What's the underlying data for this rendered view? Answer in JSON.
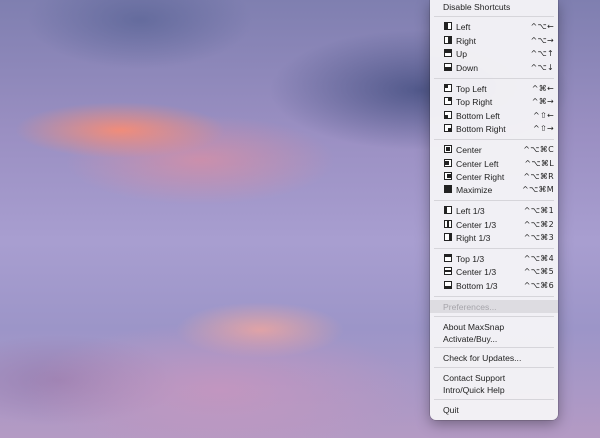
{
  "menu": {
    "disable_shortcuts": "Disable Shortcuts",
    "halves": [
      {
        "label": "Left",
        "shortcut": "^⌥←",
        "icon": "left-half-icon"
      },
      {
        "label": "Right",
        "shortcut": "^⌥→",
        "icon": "right-half-icon"
      },
      {
        "label": "Up",
        "shortcut": "^⌥↑",
        "icon": "top-half-icon"
      },
      {
        "label": "Down",
        "shortcut": "^⌥↓",
        "icon": "bottom-half-icon"
      }
    ],
    "quarters": [
      {
        "label": "Top Left",
        "shortcut": "^⌘←",
        "icon": "top-left-quarter-icon"
      },
      {
        "label": "Top Right",
        "shortcut": "^⌘→",
        "icon": "top-right-quarter-icon"
      },
      {
        "label": "Bottom Left",
        "shortcut": "^⇧←",
        "icon": "bottom-left-quarter-icon"
      },
      {
        "label": "Bottom Right",
        "shortcut": "^⇧→",
        "icon": "bottom-right-quarter-icon"
      }
    ],
    "center": [
      {
        "label": "Center",
        "shortcut": "^⌥⌘C",
        "icon": "center-icon"
      },
      {
        "label": "Center Left",
        "shortcut": "^⌥⌘L",
        "icon": "center-left-icon"
      },
      {
        "label": "Center Right",
        "shortcut": "^⌥⌘R",
        "icon": "center-right-icon"
      },
      {
        "label": "Maximize",
        "shortcut": "^⌥⌘M",
        "icon": "maximize-icon"
      }
    ],
    "thirds_vertical": [
      {
        "label": "Left 1/3",
        "shortcut": "^⌥⌘1",
        "icon": "left-third-icon"
      },
      {
        "label": "Center 1/3",
        "shortcut": "^⌥⌘2",
        "icon": "center-third-icon"
      },
      {
        "label": "Right 1/3",
        "shortcut": "^⌥⌘3",
        "icon": "right-third-icon"
      }
    ],
    "thirds_horizontal": [
      {
        "label": "Top 1/3",
        "shortcut": "^⌥⌘4",
        "icon": "top-third-icon"
      },
      {
        "label": "Center 1/3",
        "shortcut": "^⌥⌘5",
        "icon": "middle-third-icon"
      },
      {
        "label": "Bottom 1/3",
        "shortcut": "^⌥⌘6",
        "icon": "bottom-third-icon"
      }
    ],
    "preferences": "Preferences...",
    "about": "About MaxSnap",
    "activate": "Activate/Buy...",
    "check_updates": "Check for Updates...",
    "contact_support": "Contact Support",
    "intro_help": "Intro/Quick Help",
    "quit": "Quit"
  }
}
